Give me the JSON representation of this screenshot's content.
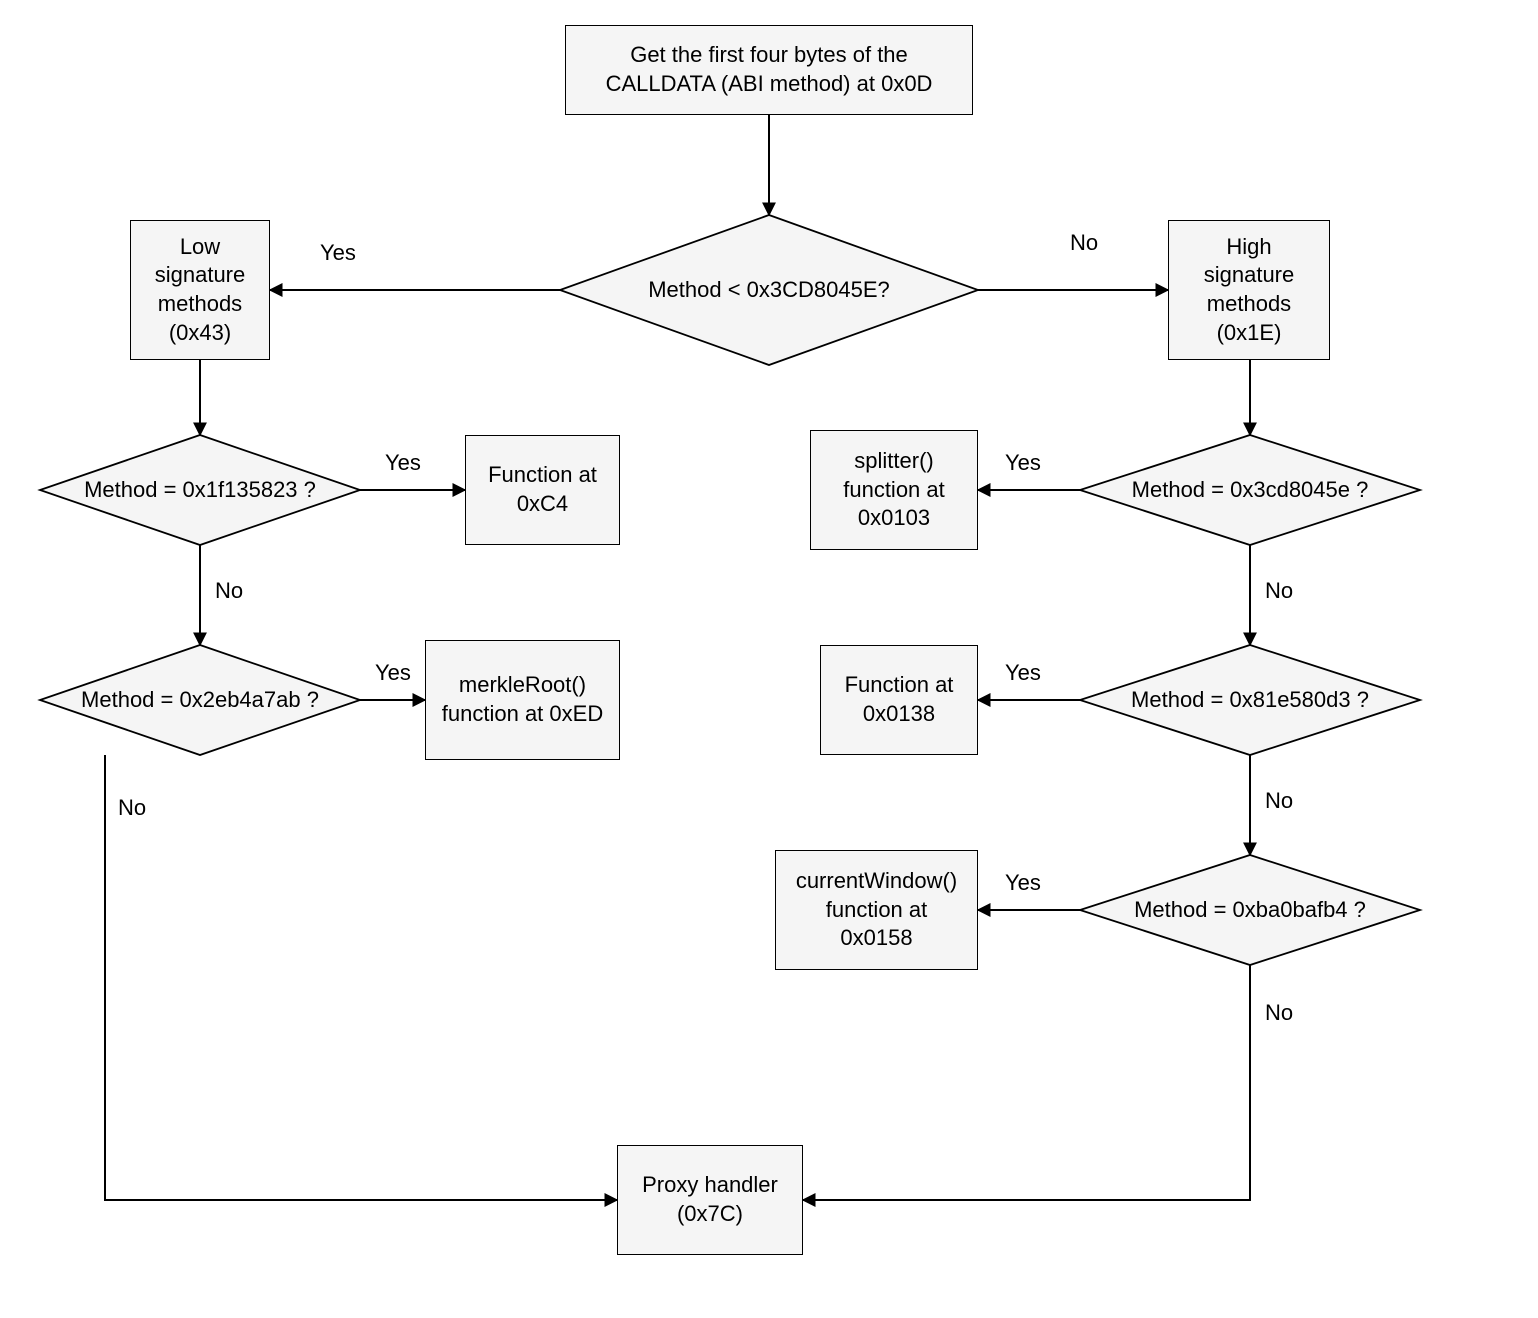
{
  "chart_data": {
    "type": "flowchart",
    "nodes": [
      {
        "id": "start",
        "kind": "process",
        "label": "Get the first four bytes of the CALLDATA (ABI method) at 0x0D"
      },
      {
        "id": "d1",
        "kind": "decision",
        "label": "Method < 0x3CD8045E?"
      },
      {
        "id": "lowbox",
        "kind": "process",
        "label": "Low signature methods (0x43)"
      },
      {
        "id": "highbox",
        "kind": "process",
        "label": "High signature methods (0x1E)"
      },
      {
        "id": "dL1",
        "kind": "decision",
        "label": "Method = 0x1f135823 ?"
      },
      {
        "id": "fC4",
        "kind": "process",
        "label": "Function at 0xC4"
      },
      {
        "id": "dL2",
        "kind": "decision",
        "label": "Method = 0x2eb4a7ab ?"
      },
      {
        "id": "fED",
        "kind": "process",
        "label": "merkleRoot() function at 0xED"
      },
      {
        "id": "dR1",
        "kind": "decision",
        "label": "Method = 0x3cd8045e ?"
      },
      {
        "id": "f103",
        "kind": "process",
        "label": "splitter() function at 0x0103"
      },
      {
        "id": "dR2",
        "kind": "decision",
        "label": "Method = 0x81e580d3 ?"
      },
      {
        "id": "f138",
        "kind": "process",
        "label": "Function at 0x0138"
      },
      {
        "id": "dR3",
        "kind": "decision",
        "label": "Method = 0xba0bafb4 ?"
      },
      {
        "id": "f158",
        "kind": "process",
        "label": "currentWindow() function at 0x0158"
      },
      {
        "id": "proxy",
        "kind": "process",
        "label": "Proxy handler (0x7C)"
      }
    ],
    "edges": [
      {
        "from": "start",
        "to": "d1",
        "label": ""
      },
      {
        "from": "d1",
        "to": "lowbox",
        "label": "Yes"
      },
      {
        "from": "d1",
        "to": "highbox",
        "label": "No"
      },
      {
        "from": "lowbox",
        "to": "dL1",
        "label": ""
      },
      {
        "from": "dL1",
        "to": "fC4",
        "label": "Yes"
      },
      {
        "from": "dL1",
        "to": "dL2",
        "label": "No"
      },
      {
        "from": "dL2",
        "to": "fED",
        "label": "Yes"
      },
      {
        "from": "dL2",
        "to": "proxy",
        "label": "No"
      },
      {
        "from": "highbox",
        "to": "dR1",
        "label": ""
      },
      {
        "from": "dR1",
        "to": "f103",
        "label": "Yes"
      },
      {
        "from": "dR1",
        "to": "dR2",
        "label": "No"
      },
      {
        "from": "dR2",
        "to": "f138",
        "label": "Yes"
      },
      {
        "from": "dR2",
        "to": "dR3",
        "label": "No"
      },
      {
        "from": "dR3",
        "to": "f158",
        "label": "Yes"
      },
      {
        "from": "dR3",
        "to": "proxy",
        "label": "No"
      }
    ]
  },
  "nodes": {
    "start": "Get the first four bytes of the CALLDATA (ABI method) at 0x0D",
    "d1": "Method < 0x3CD8045E?",
    "lowbox": "Low signature methods (0x43)",
    "highbox": "High signature methods (0x1E)",
    "dL1": "Method = 0x1f135823 ?",
    "fC4": "Function at 0xC4",
    "dL2": "Method = 0x2eb4a7ab ?",
    "fED": "merkleRoot() function at 0xED",
    "dR1": "Method = 0x3cd8045e ?",
    "f103": "splitter() function at 0x0103",
    "dR2": "Method = 0x81e580d3 ?",
    "f138": "Function at 0x0138",
    "dR3": "Method = 0xba0bafb4 ?",
    "f158": "currentWindow() function at 0x0158",
    "proxy": "Proxy handler (0x7C)"
  },
  "labels": {
    "yes": "Yes",
    "no": "No"
  }
}
